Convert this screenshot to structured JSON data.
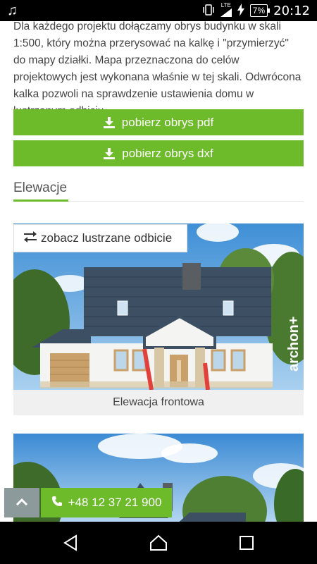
{
  "status_bar": {
    "time": "20:12",
    "battery": "7%",
    "network": "LTE",
    "music_icon": "music-note-icon",
    "vibrate_icon": "vibrate-icon",
    "signal_icon": "signal-icon",
    "charging_icon": "charging-icon"
  },
  "intro": {
    "text": "Dla każdego projektu dołączamy obrys budynku w skali 1:500, który można przerysować na kalkę i \"przymierzyć\" do mapy działki. Mapa przeznaczona do celów projektowych jest wykonana właśnie w tej skali. Odwrócona kalka pozwoli na sprawdzenie ustawienia domu w lustrzanym odbiciu."
  },
  "downloads": {
    "pdf_label": "pobierz obrys pdf",
    "dxf_label": "pobierz obrys dxf"
  },
  "section": {
    "title": "Elewacje"
  },
  "mirror_button": {
    "label": "zobacz lustrzane odbicie"
  },
  "elevation_cards": [
    {
      "caption": "Elewacja frontowa",
      "watermark": "archon+"
    }
  ],
  "floating": {
    "phone_label": "+48 12 37 21 900"
  },
  "colors": {
    "accent_green": "#6dbb2b",
    "scroll_button": "#8c9a9b",
    "caption_bg": "#f0f0f0"
  }
}
